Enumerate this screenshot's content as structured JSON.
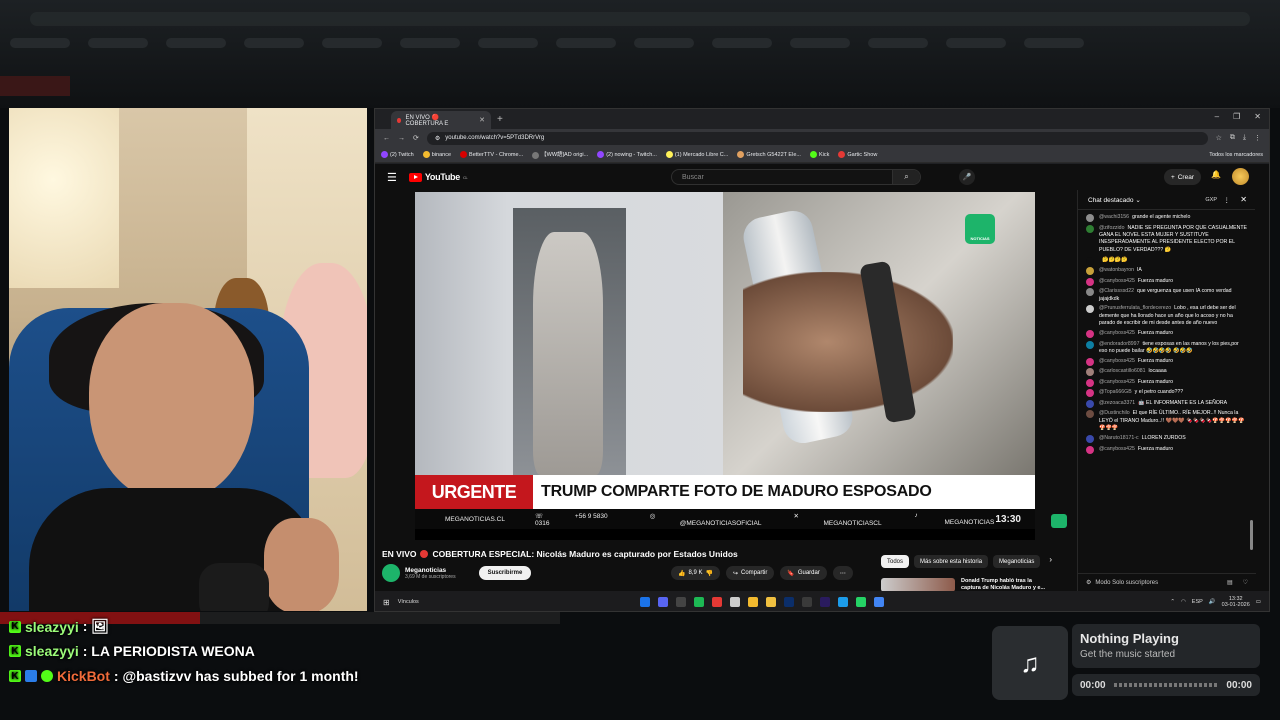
{
  "browser": {
    "tab_title": "EN VIVO 🔴 COBERTURA E",
    "url": "youtube.com/watch?v=5PTd3DRrVrg",
    "bookmarks": [
      "(2) Twitch",
      "binance",
      "BetterTTV - Chrome...",
      "【WW語]AD origi...",
      "(2) nowing - Twitch...",
      "(1) Mercado Libre C...",
      "Gretsch G5422T Ele...",
      "Kick",
      "Gartic Show",
      "Todos los marcadores"
    ]
  },
  "youtube": {
    "search_placeholder": "Buscar",
    "create_label": "Crear",
    "logo_text": "YouTube",
    "logo_region": "CL"
  },
  "video": {
    "urgent_label": "URGENTE",
    "headline": "TRUMP COMPARTE FOTO DE MADURO ESPOSADO",
    "ticker": [
      "MEGANOTICIAS.CL",
      "+56 9 5830 0316",
      "@MEGANOTICIASOFICIAL",
      "MEGANOTICIASCL",
      "MEGANOTICIAS"
    ],
    "time": "13:30",
    "logo_text": "NOTICIAS"
  },
  "watch": {
    "live_label": "EN VIVO",
    "title": "COBERTURA ESPECIAL: Nicolás Maduro es capturado por Estados Unidos",
    "channel": "Meganoticias",
    "subscribers": "3,69 M de suscriptores",
    "subscribe_label": "Suscribirme",
    "likes": "8,9 K",
    "share_label": "Compartir",
    "save_label": "Guardar",
    "chips": [
      "Todos",
      "Más sobre esta historia",
      "Meganoticias"
    ],
    "rec_title": "Donald Trump habló tras la captura de Nicolás Maduro y e..."
  },
  "chat": {
    "header": "Chat destacado",
    "gxp": "GXP",
    "footer_mode": "Modo Solo suscriptores",
    "messages": [
      {
        "user": "@wachi3156",
        "text": "grande el agente michelo",
        "color": "#8d8d8d"
      },
      {
        "user": "@zifozzido",
        "text": "NADIE SE PREGUNTA POR QUE CASUALMENTE GANA EL NOVEL ESTA MUJER Y SUSTITUYE INESPERADAMENTE AL PRESIDENTE ELECTO POR EL PUEBLO? DE VERDAD??? 🤔",
        "color": "#2e7d32"
      },
      {
        "user": "",
        "text": "🤔🤔🤔🤔",
        "color": "#0f0f0f"
      },
      {
        "user": "@watonbayron",
        "text": "IA",
        "color": "#c8a13a"
      },
      {
        "user": "@canyboss425",
        "text": "Fuerza maduro",
        "color": "#d63384"
      },
      {
        "user": "@Clarissssd22",
        "text": "que verguenza que usen IA como verdad jajajdkdk",
        "color": "#888"
      },
      {
        "user": "@Prunusferrulata_flordecerezo",
        "text": "Lobo , esa url debe ser del demente que ha llorado hace un año que lo acoso y no ha parado de escribir de mi desde antes de año nuevo",
        "color": "#ccc"
      },
      {
        "user": "@canyboss425",
        "text": "Fuerza maduro",
        "color": "#d63384"
      },
      {
        "user": "@endorador8997",
        "text": "tiene esposas en las manos y los pies,por eso no puede bailar 🤣🤣🤣🤣 🤣🤣🤣",
        "color": "#0d7fa3"
      },
      {
        "user": "@canyboss425",
        "text": "Fuerza maduro",
        "color": "#d63384"
      },
      {
        "user": "@carloscastillo6081",
        "text": "locaaaa",
        "color": "#a0807a"
      },
      {
        "user": "@canyboss425",
        "text": "Fuerza maduro",
        "color": "#d63384"
      },
      {
        "user": "@Topa666GB",
        "text": "y el petro cuando???",
        "color": "#d63384"
      },
      {
        "user": "@zezoaca3371",
        "text": "🤖 EL INFORMANTE ES LA SEÑORA",
        "color": "#3949ab"
      },
      {
        "user": "@Dustinchilo",
        "text": "El que RÍE ÚLTIMO.. RÍE MEJOR..!! Nunca la LEYÓ el TIRANO Maduro..!! 🤎🤎🤎 🍫🍫🍫🍫🍄🍄🍄🍄🍄🍄🍄🍄",
        "color": "#6d4c41"
      },
      {
        "user": "@Naruto18171-c",
        "text": "LLOREN ZURDOS",
        "color": "#3949ab"
      },
      {
        "user": "@canyboss425",
        "text": "Fuerza maduro",
        "color": "#d63384"
      }
    ]
  },
  "taskbar": {
    "label": "Vínculos",
    "lang": "ESP",
    "clock_time": "13:32",
    "clock_date": "03-01-2026"
  },
  "stream_chat": [
    {
      "user": "sleazyyi",
      "text": ": 🖼",
      "bot": false
    },
    {
      "user": "sleazyyi",
      "text": ": LA PERIODISTA WEONA",
      "bot": false
    },
    {
      "user": "KickBot",
      "text": ": @bastizvv has subbed for 1 month!",
      "bot": true
    }
  ],
  "music": {
    "title": "Nothing Playing",
    "subtitle": "Get the music started",
    "elapsed": "00:00",
    "total": "00:00"
  }
}
